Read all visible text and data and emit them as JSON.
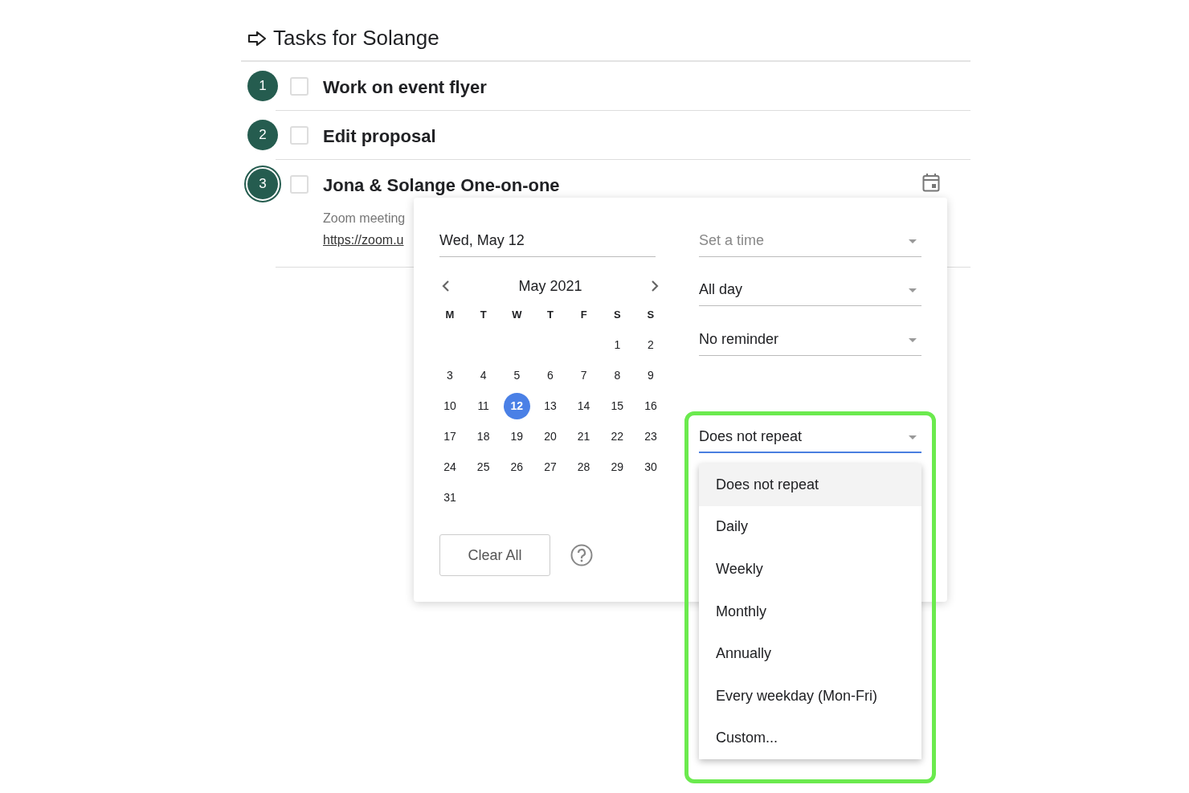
{
  "title": "Tasks for Solange",
  "tasks": [
    {
      "number": "1",
      "title": "Work on event flyer",
      "checked": false,
      "selected": false
    },
    {
      "number": "2",
      "title": "Edit proposal",
      "checked": false,
      "selected": false
    },
    {
      "number": "3",
      "title": "Jona & Solange One-on-one",
      "checked": false,
      "selected": true,
      "notes": "Zoom meeting",
      "link": "https://zoom.u"
    }
  ],
  "date_picker": {
    "date_field": {
      "value": "Wed, May 12"
    },
    "month": "May 2021",
    "weekdays": [
      "M",
      "T",
      "W",
      "T",
      "F",
      "S",
      "S"
    ],
    "weeks": [
      [
        {
          "label": "1",
          "selected": false
        },
        {
          "label": "2",
          "selected": false
        }
      ],
      [
        {
          "label": "3",
          "selected": false
        },
        {
          "label": "4",
          "selected": false
        },
        {
          "label": "5",
          "selected": false
        },
        {
          "label": "6",
          "selected": false
        },
        {
          "label": "7",
          "selected": false
        },
        {
          "label": "8",
          "selected": false
        },
        {
          "label": "9",
          "selected": false
        }
      ],
      [
        {
          "label": "10",
          "selected": false
        },
        {
          "label": "11",
          "selected": false
        },
        {
          "label": "12",
          "selected": true
        },
        {
          "label": "13",
          "selected": false
        },
        {
          "label": "14",
          "selected": false
        },
        {
          "label": "15",
          "selected": false
        },
        {
          "label": "16",
          "selected": false
        }
      ],
      [
        {
          "label": "17",
          "selected": false
        },
        {
          "label": "18",
          "selected": false
        },
        {
          "label": "19",
          "selected": false
        },
        {
          "label": "20",
          "selected": false
        },
        {
          "label": "21",
          "selected": false
        },
        {
          "label": "22",
          "selected": false
        },
        {
          "label": "23",
          "selected": false
        }
      ],
      [
        {
          "label": "24",
          "selected": false
        },
        {
          "label": "25",
          "selected": false
        },
        {
          "label": "26",
          "selected": false
        },
        {
          "label": "27",
          "selected": false
        },
        {
          "label": "28",
          "selected": false
        },
        {
          "label": "29",
          "selected": false
        },
        {
          "label": "30",
          "selected": false
        }
      ],
      [
        {
          "label": "31",
          "selected": false
        }
      ]
    ],
    "clear_button": "Clear All",
    "time_field": {
      "placeholder": "Set a time"
    },
    "all_day_field": {
      "value": "All day"
    },
    "reminder_field": {
      "value": "No reminder"
    },
    "repeat_field": {
      "value": "Does not repeat",
      "focused": true
    },
    "repeat_menu": [
      {
        "label": "Does not repeat",
        "selected": true
      },
      {
        "label": "Daily",
        "selected": false
      },
      {
        "label": "Weekly",
        "selected": false
      },
      {
        "label": "Monthly",
        "selected": false
      },
      {
        "label": "Annually",
        "selected": false
      },
      {
        "label": "Every weekday (Mon-Fri)",
        "selected": false
      },
      {
        "label": "Custom...",
        "selected": false
      }
    ]
  }
}
